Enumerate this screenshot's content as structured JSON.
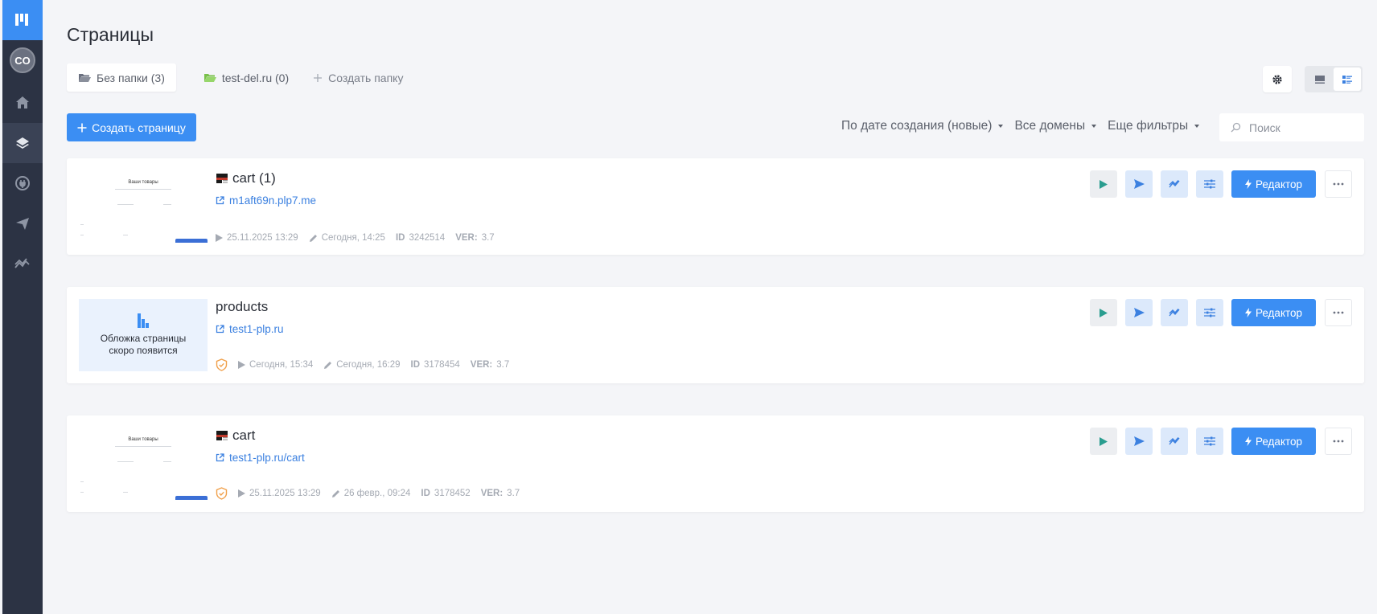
{
  "page": {
    "title": "Страницы"
  },
  "sidebar": {
    "avatar": "CO",
    "items": [
      {
        "icon": "home-icon"
      },
      {
        "icon": "layers-icon",
        "active": true
      },
      {
        "icon": "plug-icon"
      },
      {
        "icon": "send-icon"
      },
      {
        "icon": "analytics-icon"
      }
    ]
  },
  "folders": [
    {
      "label": "Без папки (3)",
      "icon": "folder-open-icon",
      "active": true
    },
    {
      "label": "test-del.ru (0)",
      "icon": "folder-green-icon"
    },
    {
      "label": "Создать папку",
      "icon": "plus-icon"
    }
  ],
  "toolbar": {
    "create_label": "Создать страницу",
    "sort_label": "По дате создания (новые)",
    "domains_label": "Все домены",
    "filters_label": "Еще фильтры",
    "search_placeholder": "Поиск"
  },
  "pages": [
    {
      "title": "cart (1)",
      "link": "m1aft69n.plp7.me",
      "published": "25.11.2025 13:29",
      "edited": "Сегодня, 14:25",
      "id_label": "ID",
      "id": "3242514",
      "ver_label": "VER:",
      "ver": "3.7",
      "thumb_title": "Ваши товары",
      "shield": false,
      "editor_label": "Редактор"
    },
    {
      "title": "products",
      "link": "test1-plp.ru",
      "published": "Сегодня, 15:34",
      "edited": "Сегодня, 16:29",
      "id_label": "ID",
      "id": "3178454",
      "ver_label": "VER:",
      "ver": "3.7",
      "placeholder_line1": "Обложка страницы",
      "placeholder_line2": "скоро появится",
      "shield": true,
      "editor_label": "Редактор"
    },
    {
      "title": "cart",
      "link": "test1-plp.ru/cart",
      "published": "25.11.2025 13:29",
      "edited": "26 февр., 09:24",
      "id_label": "ID",
      "id": "3178452",
      "ver_label": "VER:",
      "ver": "3.7",
      "thumb_title": "Ваши товары",
      "shield": true,
      "editor_label": "Редактор"
    }
  ],
  "colors": {
    "accent": "#3b8ef3",
    "sidebar": "#2c3344",
    "link": "#3b80e0",
    "shield": "#f0a04b"
  }
}
